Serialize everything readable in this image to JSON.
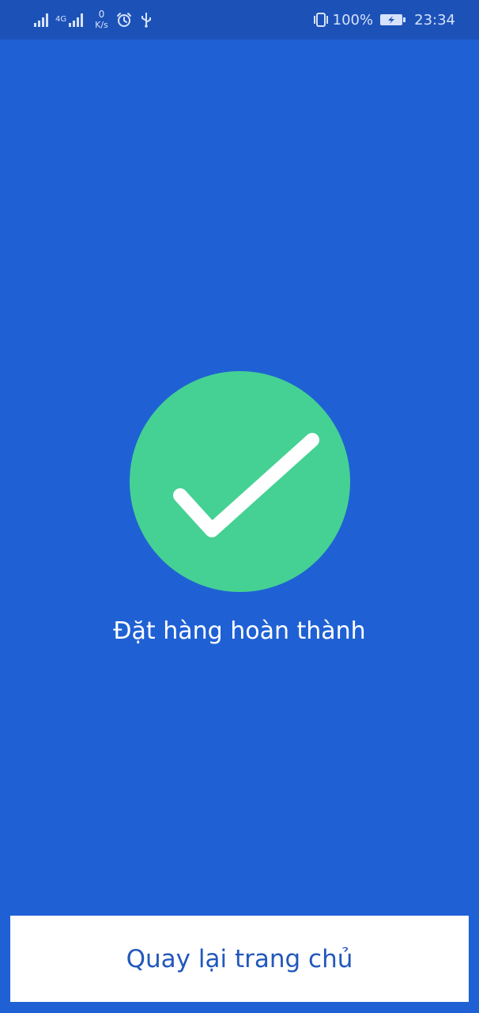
{
  "status_bar": {
    "network_type": "4G",
    "speed_value": "0",
    "speed_unit": "K/s",
    "battery_percent": "100%",
    "time": "23:34",
    "icons": [
      "signal-icon",
      "signal-4g-icon",
      "alarm-icon",
      "usb-icon",
      "vibrate-icon",
      "battery-charging-icon"
    ]
  },
  "main": {
    "status_icon": "check-circle-icon",
    "message": "Đặt hàng hoàn thành"
  },
  "footer": {
    "home_button_label": "Quay lại trang chủ"
  },
  "colors": {
    "background": "#1f61d4",
    "status_bar": "#1c52b8",
    "success": "#45d193",
    "button_text": "#2258ba",
    "button_background": "#ffffff"
  }
}
